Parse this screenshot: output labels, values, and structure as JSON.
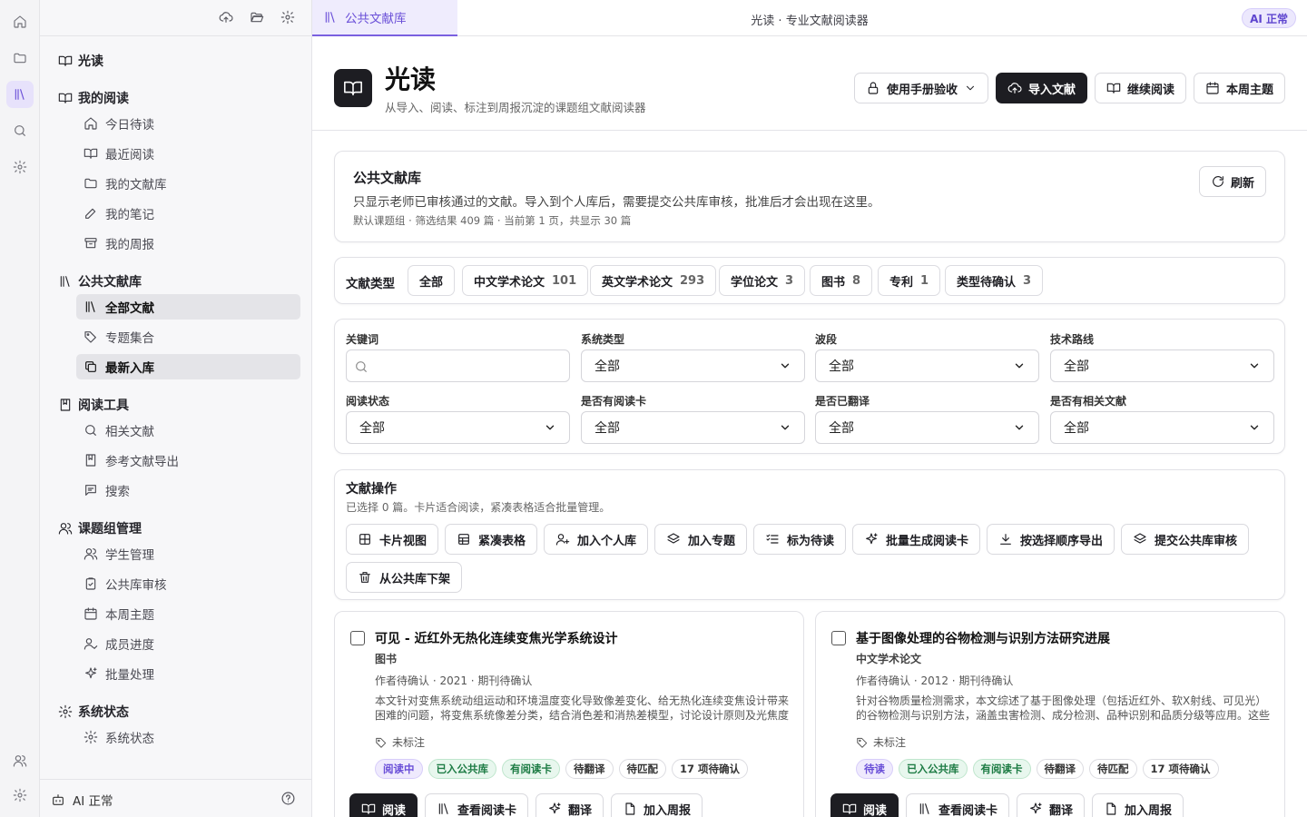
{
  "app": {
    "title": "光读 · 专业文献阅读器",
    "ai_status": "AI 正常"
  },
  "tabs": [
    {
      "label": "公共文献库"
    }
  ],
  "sidebar": {
    "brand": "光读",
    "sections": [
      {
        "label": "我的阅读",
        "icon": "book-open-icon",
        "items": [
          {
            "label": "今日待读",
            "icon": "home-icon"
          },
          {
            "label": "最近阅读",
            "icon": "book-open-icon"
          },
          {
            "label": "我的文献库",
            "icon": "folder-icon"
          },
          {
            "label": "我的笔记",
            "icon": "pen-icon"
          },
          {
            "label": "我的周报",
            "icon": "archive-icon"
          }
        ]
      },
      {
        "label": "公共文献库",
        "icon": "library-icon",
        "items": [
          {
            "label": "全部文献",
            "icon": "library-icon"
          },
          {
            "label": "专题集合",
            "icon": "tags-icon"
          },
          {
            "label": "最新入库",
            "icon": "copy-icon"
          }
        ]
      },
      {
        "label": "阅读工具",
        "icon": "bookmark-book-icon",
        "items": [
          {
            "label": "相关文献",
            "icon": "search-icon"
          },
          {
            "label": "参考文献导出",
            "icon": "bookmark-book-icon"
          },
          {
            "label": "搜索",
            "icon": "message-icon"
          }
        ]
      },
      {
        "label": "课题组管理",
        "icon": "users-icon",
        "items": [
          {
            "label": "学生管理",
            "icon": "users-icon"
          },
          {
            "label": "公共库审核",
            "icon": "clipboard-icon"
          },
          {
            "label": "本周主题",
            "icon": "calendar-icon"
          },
          {
            "label": "成员进度",
            "icon": "user-check-icon"
          },
          {
            "label": "批量处理",
            "icon": "sparkles-icon"
          }
        ]
      },
      {
        "label": "系统状态",
        "icon": "gear-icon",
        "items": [
          {
            "label": "系统状态",
            "icon": "gear-icon"
          }
        ]
      }
    ],
    "footer": {
      "ai_label": "AI 正常"
    }
  },
  "header": {
    "title": "光读",
    "subtitle": "从导入、阅读、标注到周报沉淀的课题组文献阅读器",
    "buttons": {
      "manual": "使用手册验收",
      "import": "导入文献",
      "continue": "继续阅读",
      "theme": "本周主题"
    }
  },
  "library": {
    "title": "公共文献库",
    "description": "只显示老师已审核通过的文献。导入到个人库后，需要提交公共库审核，批准后才会出现在这里。",
    "meta": "默认课题组 · 筛选结果 409 篇 · 当前第 1 页，共显示 30 篇",
    "refresh": "刷新"
  },
  "types": {
    "label": "文献类型",
    "chips": [
      {
        "label": "全部",
        "count": ""
      },
      {
        "label": "中文学术论文",
        "count": "101"
      },
      {
        "label": "英文学术论文",
        "count": "293"
      },
      {
        "label": "学位论文",
        "count": "3"
      },
      {
        "label": "图书",
        "count": "8"
      },
      {
        "label": "专利",
        "count": "1"
      },
      {
        "label": "类型待确认",
        "count": "3"
      }
    ]
  },
  "filters": {
    "keyword": {
      "label": "关键词",
      "placeholder": ""
    },
    "selects": [
      {
        "label": "系统类型",
        "value": "全部"
      },
      {
        "label": "波段",
        "value": "全部"
      },
      {
        "label": "技术路线",
        "value": "全部"
      },
      {
        "label": "阅读状态",
        "value": "全部"
      },
      {
        "label": "是否有阅读卡",
        "value": "全部"
      },
      {
        "label": "是否已翻译",
        "value": "全部"
      },
      {
        "label": "是否有相关文献",
        "value": "全部"
      }
    ]
  },
  "ops": {
    "title": "文献操作",
    "description": "已选择 0 篇。卡片适合阅读，紧凑表格适合批量管理。",
    "buttons": [
      {
        "label": "卡片视图",
        "icon": "grid-icon"
      },
      {
        "label": "紧凑表格",
        "icon": "table-icon"
      },
      {
        "label": "加入个人库",
        "icon": "user-plus-icon"
      },
      {
        "label": "加入专题",
        "icon": "layers-icon"
      },
      {
        "label": "标为待读",
        "icon": "list-check-icon"
      },
      {
        "label": "批量生成阅读卡",
        "icon": "sparkles-icon"
      },
      {
        "label": "按选择顺序导出",
        "icon": "download-icon"
      },
      {
        "label": "提交公共库审核",
        "icon": "layers-icon"
      },
      {
        "label": "从公共库下架",
        "icon": "trash-icon"
      }
    ]
  },
  "documents": [
    {
      "title": "可见 - 近红外无热化连续变焦光学系统设计",
      "kind": "图书",
      "meta": "作者待确认 · 2021 · 期刊待确认",
      "summary": "本文针对变焦系统动组运动和环境温度变化导致像差变化、给无热化连续变焦设计带来困难的问题，将变焦系统像差分类，结合消色差和消热差模型，讨论设计原则及光焦度分配方法。",
      "note": "未标注",
      "tags": [
        {
          "label": "阅读中",
          "style": "purple"
        },
        {
          "label": "已入公共库",
          "style": "green"
        },
        {
          "label": "有阅读卡",
          "style": "green"
        },
        {
          "label": "待翻译",
          "style": "plain"
        },
        {
          "label": "待匹配",
          "style": "plain"
        },
        {
          "label": "17 项待确认",
          "style": "plain"
        }
      ],
      "actions": {
        "read": "阅读",
        "card": "查看阅读卡",
        "translate": "翻译",
        "weekly": "加入周报"
      }
    },
    {
      "title": "基于图像处理的谷物检测与识别方法研究进展",
      "kind": "中文学术论文",
      "meta": "作者待确认 · 2012 · 期刊待确认",
      "summary": "针对谷物质量检测需求，本文综述了基于图像处理（包括近红外、软X射线、可见光）的谷物检测与识别方法，涵盖虫害检测、成分检测、品种识别和品质分级等应用。这些方法具有快速无损的特点。",
      "note": "未标注",
      "tags": [
        {
          "label": "待读",
          "style": "purple"
        },
        {
          "label": "已入公共库",
          "style": "green"
        },
        {
          "label": "有阅读卡",
          "style": "green"
        },
        {
          "label": "待翻译",
          "style": "plain"
        },
        {
          "label": "待匹配",
          "style": "plain"
        },
        {
          "label": "17 项待确认",
          "style": "plain"
        }
      ],
      "actions": {
        "read": "阅读",
        "card": "查看阅读卡",
        "translate": "翻译",
        "weekly": "加入周报"
      }
    }
  ]
}
